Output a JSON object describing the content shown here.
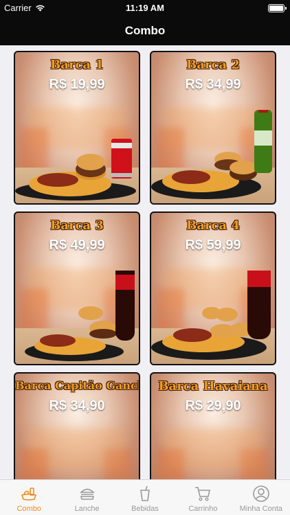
{
  "status": {
    "carrier": "Carrier",
    "time": "11:19 AM"
  },
  "nav": {
    "title": "Combo"
  },
  "combos": [
    {
      "name": "Barca 1",
      "price": "R$ 19,99",
      "drink": "can"
    },
    {
      "name": "Barca 2",
      "price": "R$ 34,99",
      "drink": "guarana"
    },
    {
      "name": "Barca 3",
      "price": "R$ 49,99",
      "drink": "bottle"
    },
    {
      "name": "Barca 4",
      "price": "R$ 59,99",
      "drink": "bottle"
    },
    {
      "name": "Barca Capitão Gancho",
      "price": "R$ 34,90",
      "drink": "none"
    },
    {
      "name": "Barca Havaiana",
      "price": "R$ 29,90",
      "drink": "none"
    }
  ],
  "tabs": [
    {
      "label": "Combo",
      "icon": "combo-icon",
      "active": true
    },
    {
      "label": "Lanche",
      "icon": "burger-icon",
      "active": false
    },
    {
      "label": "Bebidas",
      "icon": "drink-icon",
      "active": false
    },
    {
      "label": "Carrinho",
      "icon": "cart-icon",
      "active": false
    },
    {
      "label": "Minha Conta",
      "icon": "account-icon",
      "active": false
    }
  ],
  "colors": {
    "accent": "#f08a1c",
    "bar": "#0b0b0b",
    "title_orange": "#f39c1f"
  }
}
